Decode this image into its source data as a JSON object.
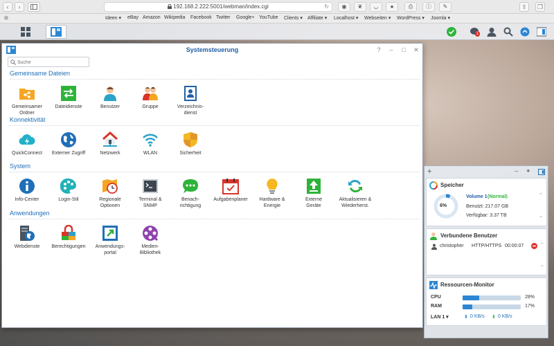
{
  "browser": {
    "url": "192.168.2.222:5001/webman/index.cgi",
    "nav": {
      "back": "‹",
      "forward": "›"
    },
    "bookmarks": [
      "Ideen ▾",
      "eBay",
      "Amazon",
      "Wikipedia",
      "Facebook",
      "Twitter",
      "Google+",
      "YouTube",
      "Clients ▾",
      "Affiliate ▾",
      "Localhost ▾",
      "Webseiten ▾",
      "WordPress ▾",
      "Joomla ▾"
    ]
  },
  "taskbar": {
    "notification_count": "1",
    "colors": {
      "status_ok": "#2eb33a",
      "notification": "#d9342b"
    }
  },
  "window": {
    "title": "Systemsteuerung",
    "search_placeholder": "Suche",
    "controls": {
      "help": "?",
      "minimize": "–",
      "maximize": "□",
      "close": "✕"
    },
    "sections": [
      {
        "title": "Gemeinsame Dateien",
        "apps": [
          {
            "l1": "Gemeinsamer",
            "l2": "Ordner",
            "icon": "shared-folder-icon",
            "color": "#f5a623"
          },
          {
            "l1": "Dateidienste",
            "l2": "",
            "icon": "file-services-icon",
            "color": "#2eb33a"
          },
          {
            "l1": "Benutzer",
            "l2": "",
            "icon": "user-icon",
            "color": "#2ba3c8"
          },
          {
            "l1": "Gruppe",
            "l2": "",
            "icon": "group-icon",
            "color": "#d9342b"
          },
          {
            "l1": "Verzeichnis-",
            "l2": "dienst",
            "icon": "directory-icon",
            "color": "#1f5fa8"
          }
        ]
      },
      {
        "title": "Konnektivität",
        "apps": [
          {
            "l1": "QuickConnect",
            "l2": "",
            "icon": "quickconnect-icon",
            "color": "#21b1c9"
          },
          {
            "l1": "Externer Zugriff",
            "l2": "",
            "icon": "globe-icon",
            "color": "#1f6fb8"
          },
          {
            "l1": "Netzwerk",
            "l2": "",
            "icon": "network-home-icon",
            "color": "#d9342b"
          },
          {
            "l1": "WLAN",
            "l2": "",
            "icon": "wifi-icon",
            "color": "#2ba3c8"
          },
          {
            "l1": "Sicherheit",
            "l2": "",
            "icon": "shield-icon",
            "color": "#f5b823"
          }
        ]
      },
      {
        "title": "System",
        "apps": [
          {
            "l1": "Info-Center",
            "l2": "",
            "icon": "info-icon",
            "color": "#1f6fb8"
          },
          {
            "l1": "Login-Stil",
            "l2": "",
            "icon": "palette-icon",
            "color": "#21b1b9"
          },
          {
            "l1": "Regionale",
            "l2": "Optionen",
            "icon": "regional-clock-icon",
            "color": "#f5a623"
          },
          {
            "l1": "Terminal &",
            "l2": "SNMP",
            "icon": "terminal-icon",
            "color": "#4a5560"
          },
          {
            "l1": "Benach-",
            "l2": "richtigung",
            "icon": "chat-bubble-icon",
            "color": "#2eb33a"
          },
          {
            "l1": "Aufgabenplaner",
            "l2": "",
            "icon": "calendar-icon",
            "color": "#d9342b"
          },
          {
            "l1": "Hardware &",
            "l2": "Energie",
            "icon": "lightbulb-icon",
            "color": "#f5b823"
          },
          {
            "l1": "Externe",
            "l2": "Geräte",
            "icon": "external-device-icon",
            "color": "#2eb33a"
          },
          {
            "l1": "Aktualisieren &",
            "l2": "Wiederherst.",
            "icon": "update-icon",
            "color": "#2ba3c8"
          }
        ]
      },
      {
        "title": "Anwendungen",
        "apps": [
          {
            "l1": "Webdienste",
            "l2": "",
            "icon": "web-services-icon",
            "color": "#4a5560"
          },
          {
            "l1": "Berechtigungen",
            "l2": "",
            "icon": "permissions-icon",
            "color": "#d9342b"
          },
          {
            "l1": "Anwendungs-",
            "l2": "portal",
            "icon": "app-portal-icon",
            "color": "#2eb33a"
          },
          {
            "l1": "Medien-",
            "l2": "Bibliothek",
            "icon": "media-library-icon",
            "color": "#8e44ad"
          }
        ]
      }
    ]
  },
  "widgets": {
    "add": "+",
    "storage": {
      "title": "Speicher",
      "percent_label": "6%",
      "percent": 6,
      "volume_name": "Volume 1",
      "volume_status": "(Normal)",
      "used": "Benutzt: 217.07 GB",
      "free": "Verfügbar: 3.37 TB"
    },
    "users": {
      "title": "Verbundene Benutzer",
      "rows": [
        {
          "name": "christopher",
          "protocol": "HTTP/HTTPS",
          "time": "00:00:07"
        }
      ]
    },
    "resources": {
      "title": "Ressourcen-Monitor",
      "cpu_label": "CPU",
      "cpu_value": "28%",
      "cpu_percent": 28,
      "ram_label": "RAM",
      "ram_value": "17%",
      "ram_percent": 17,
      "lan_label": "LAN 1 ▾",
      "upload": "0 KB/s",
      "download": "0 KB/s",
      "colors": {
        "bar": "#2d86d3",
        "upload": "#2d86d3",
        "download": "#2eb33a"
      }
    }
  }
}
